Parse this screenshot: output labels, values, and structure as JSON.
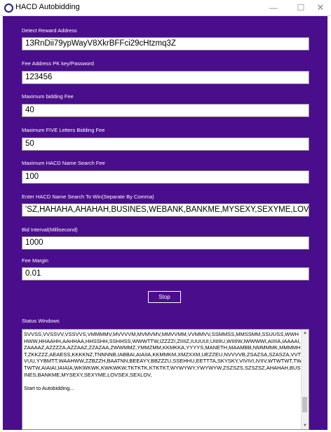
{
  "window": {
    "title": "HACD Autobidding",
    "app_icon": "circle-app-icon",
    "minimize_glyph": "—",
    "maximize_glyph": "☐",
    "close_glyph": "✕"
  },
  "colors": {
    "background": "#4a0d8c",
    "text": "#ffffff",
    "field_bg": "#ffffff"
  },
  "form": {
    "reward_address": {
      "label": "Detect Reward Address",
      "value": "13RnDii79ypWayV8XkrBFFci29cHtzmq3Z"
    },
    "fee_address": {
      "label": "Fee Address PK key/Password",
      "value": "123456"
    },
    "max_bidding_fee": {
      "label": "Maximum bidding Fee",
      "value": "40"
    },
    "max_five_letters_fee": {
      "label": "Maximum FIVE Letters Bidding Fee",
      "value": "50"
    },
    "max_hacd_name_search_fee": {
      "label": "Maximum HACD Name Search Fee",
      "value": "100"
    },
    "hacd_names": {
      "label": "Enter HACD Name Search To Win(Separate By Comma)",
      "value": "'SZ,HAHAHA,AHAHAH,BUSINES,WEBANK,BANKME,MYSEXY,SEXYME,LOVSEX,SEXLOV"
    },
    "bid_interval": {
      "label": "Bid Interval(Millisecond)",
      "value": "1000"
    },
    "fee_margin": {
      "label": "Fee Margin",
      "value": "0.01"
    }
  },
  "stop_button": {
    "label": "Stop"
  },
  "status": {
    "label": "Status Windows",
    "text": "SVVSS,VVSSVV,VSSVVS,VMMMMV,MVVVVM,MVMVMV,MMVVMM,VVMMVV,SSMMSS,MMSSMM,SSUUSS,WWHHWW,HHAAHH,AAHHAA,HHSSHH,SSHHSS,WWWTTW,IZZZZI,ZIIIIZ,IUUUUI,UIIIIIU,WIIIIW,IWWWWI,AIIIIA,IAAAAI,ZAAAAZ,AZZZZA,AZZAAZ,ZZAZAA,ZWWMMZ,YMMZMM,KKMKKA,YYYYS,MANETH,MAAMBB,NMMMMK,MMMMHT,ZKKZZZ,AEAESS,KKKKNZ,TNNNNB,IABBAI,AIAIIA,KKMMKM,XMZXXM,UEZZEU,NVVVVB,ZSAZSA,SZASZA,VVTVUU,YYBMTT,WAAHWW,ZZBZZH,BAATNN,BEEAYY,BBZZZU,SSEHHU,EETTTA,SKYSKY,VIVIVI,IVIIV,WTWTWT,TWTWTW,AIAIAI,IAIAIA,WKWKWK,KWKWKW,TKTKTK,KTKTKT,WYWYWY,YWYWYW,ZSZSZS,SZSZSZ,AHAHAH,BUSINES,BANKME,MYSEXY,SEXYME,LOVSEX,SEXLOV,\n\nStart to Autobidding..."
  }
}
